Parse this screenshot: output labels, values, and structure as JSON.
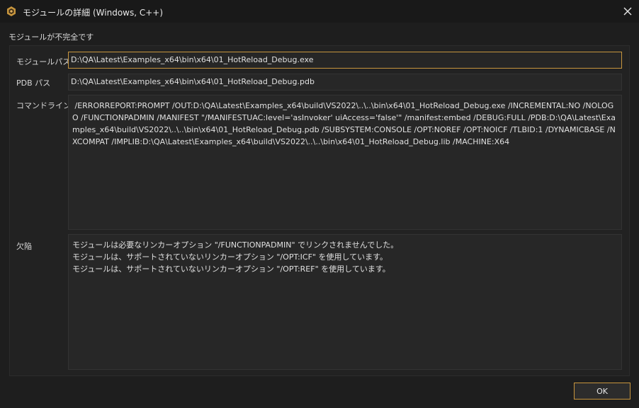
{
  "window": {
    "title": "モジュールの詳細 (Windows, C++)",
    "app_icon": "app-logo-icon",
    "close_icon": "close-icon"
  },
  "status": "モジュールが不完全です",
  "fields": {
    "module_path": {
      "label": "モジュールパス",
      "value": "D:\\QA\\Latest\\Examples_x64\\bin\\x64\\01_HotReload_Debug.exe"
    },
    "pdb_path": {
      "label": "PDB パス",
      "value": "D:\\QA\\Latest\\Examples_x64\\bin\\x64\\01_HotReload_Debug.pdb"
    },
    "command_line": {
      "label": "コマンドライン",
      "value": " /ERRORREPORT:PROMPT /OUT:D:\\QA\\Latest\\Examples_x64\\build\\VS2022\\..\\..\\bin\\x64\\01_HotReload_Debug.exe /INCREMENTAL:NO /NOLOGO /FUNCTIONPADMIN /MANIFEST \"/MANIFESTUAC:level='asInvoker' uiAccess='false'\" /manifest:embed /DEBUG:FULL /PDB:D:\\QA\\Latest\\Examples_x64\\build\\VS2022\\..\\..\\bin\\x64\\01_HotReload_Debug.pdb /SUBSYSTEM:CONSOLE /OPT:NOREF /OPT:NOICF /TLBID:1 /DYNAMICBASE /NXCOMPAT /IMPLIB:D:\\QA\\Latest\\Examples_x64\\build\\VS2022\\..\\..\\bin\\x64\\01_HotReload_Debug.lib /MACHINE:X64"
    },
    "defects": {
      "label": "欠陥",
      "value": "モジュールは必要なリンカーオプション \"/FUNCTIONPADMIN\" でリンクされませんでした。\nモジュールは、サポートされていないリンカーオプション \"/OPT:ICF\" を使用しています。\nモジュールは、サポートされていないリンカーオプション \"/OPT:REF\" を使用しています。"
    }
  },
  "buttons": {
    "ok_label": "OK"
  },
  "colors": {
    "accent": "#c8963e",
    "background": "#1e1e1e",
    "field_background": "#272727",
    "text": "#e0e0e0"
  }
}
